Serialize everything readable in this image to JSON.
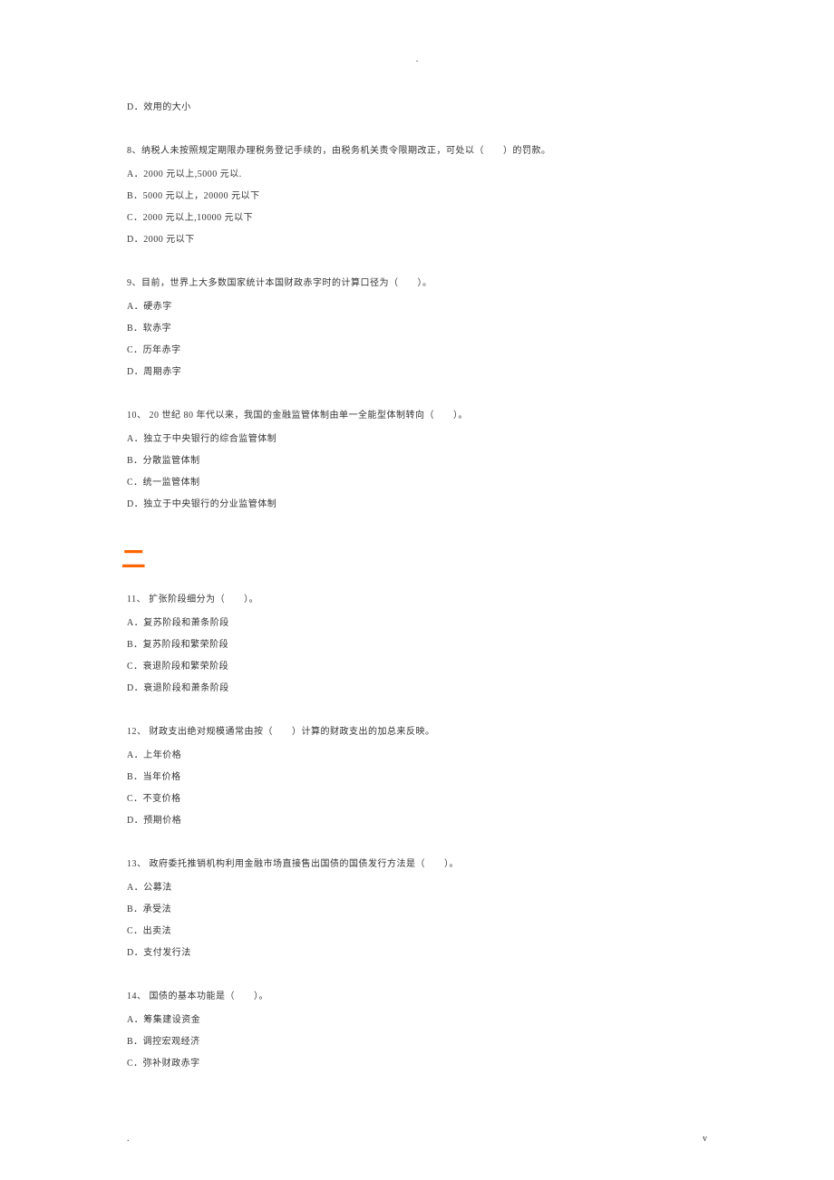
{
  "header": {
    "marker": "."
  },
  "q7_tail": {
    "options": {
      "D": "D．效用的大小"
    }
  },
  "q8": {
    "text": "8、纳税人未按照规定期限办理税务登记手续的，由税务机关责令限期改正，可处以（　　）的罚款。",
    "options": {
      "A": "A．2000 元以上,5000 元以.",
      "B": "B．5000 元以上，20000 元以下",
      "C": "C．2000 元以上,10000 元以下",
      "D": "D．2000 元以下"
    }
  },
  "q9": {
    "text": "9、目前，世界上大多数国家统计本国财政赤字时的计算口径为（　　）。",
    "options": {
      "A": "A．硬赤字",
      "B": "B．软赤字",
      "C": "C．历年赤字",
      "D": "D．周期赤字"
    }
  },
  "q10": {
    "text": "10、 20 世纪 80 年代以来，我国的金融监管体制由单一全能型体制转向（　　）。",
    "options": {
      "A": "A．独立于中央银行的综合监管体制",
      "B": "B．分散监管体制",
      "C": "C．统一监管体制",
      "D": "D．独立于中央银行的分业监管体制"
    }
  },
  "section_two": "二",
  "q11": {
    "text": "11、 扩张阶段细分为（　　）。",
    "options": {
      "A": "A．复苏阶段和萧条阶段",
      "B": "B．复苏阶段和繁荣阶段",
      "C": "C．衰退阶段和繁荣阶段",
      "D": "D．衰退阶段和萧条阶段"
    }
  },
  "q12": {
    "text": "12、 财政支出绝对规模通常由按（　　）计算的财政支出的加总来反映。",
    "options": {
      "A": "A．上年价格",
      "B": "B．当年价格",
      "C": "C．不变价格",
      "D": "D．预期价格"
    }
  },
  "q13": {
    "text": "13、 政府委托推销机构利用金融市场直接售出国债的国债发行方法是（　　）。",
    "options": {
      "A": "A．公募法",
      "B": "B．承受法",
      "C": "C．出卖法",
      "D": "D．支付发行法"
    }
  },
  "q14": {
    "text": "14、 国债的基本功能是（　　）。",
    "options": {
      "A": "A．筹集建设资金",
      "B": "B．调控宏观经济",
      "C": "C．弥补财政赤字"
    }
  },
  "footer": {
    "left": ".",
    "right": "v"
  }
}
